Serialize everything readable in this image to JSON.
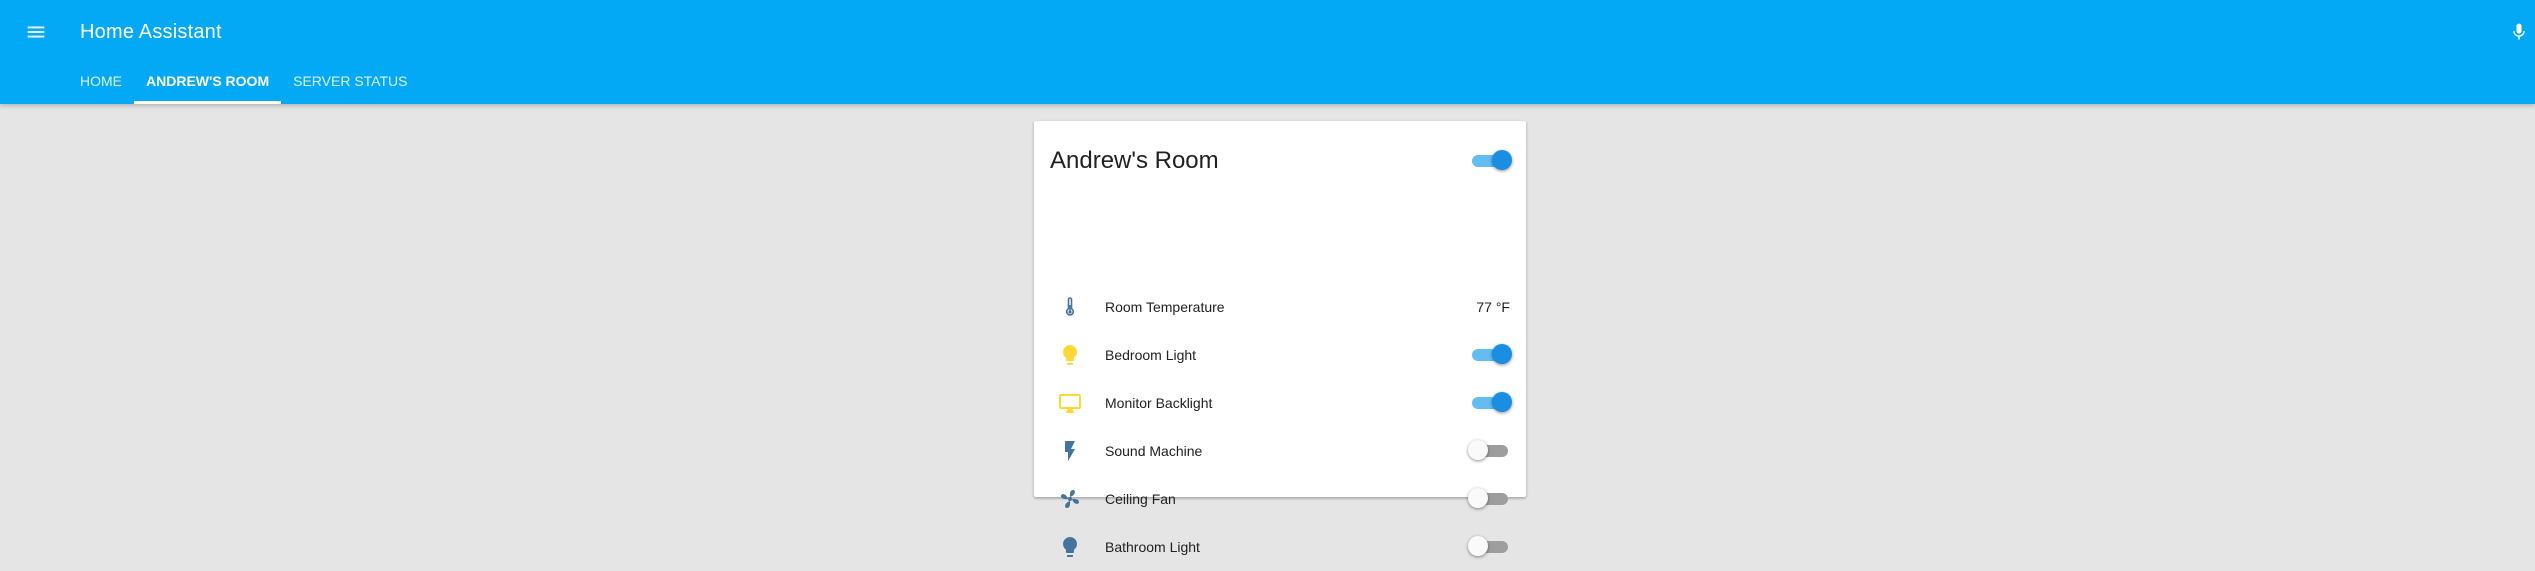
{
  "app": {
    "title": "Home Assistant",
    "accent_color": "#03a9f4",
    "menu_icon": "menu-icon",
    "mic_icon": "microphone-icon"
  },
  "tabs": [
    {
      "label": "HOME",
      "active": false
    },
    {
      "label": "ANDREW'S ROOM",
      "active": true
    },
    {
      "label": "SERVER STATUS",
      "active": false
    }
  ],
  "card": {
    "title": "Andrew's Room",
    "master_toggle_on": true,
    "rows": [
      {
        "label": "Room Temperature",
        "icon": "thermometer-icon",
        "icon_color": "#44739e",
        "value": "77 °F"
      },
      {
        "label": "Bedroom Light",
        "icon": "lightbulb-icon",
        "icon_color": "#fdd835",
        "toggle": true
      },
      {
        "label": "Monitor Backlight",
        "icon": "monitor-icon",
        "icon_color": "#fdd835",
        "toggle": true
      },
      {
        "label": "Sound Machine",
        "icon": "flash-icon",
        "icon_color": "#44739e",
        "toggle": false
      },
      {
        "label": "Ceiling Fan",
        "icon": "fan-icon",
        "icon_color": "#44739e",
        "toggle": false
      },
      {
        "label": "Bathroom Light",
        "icon": "lightbulb-icon",
        "icon_color": "#44739e",
        "toggle": false
      }
    ]
  }
}
